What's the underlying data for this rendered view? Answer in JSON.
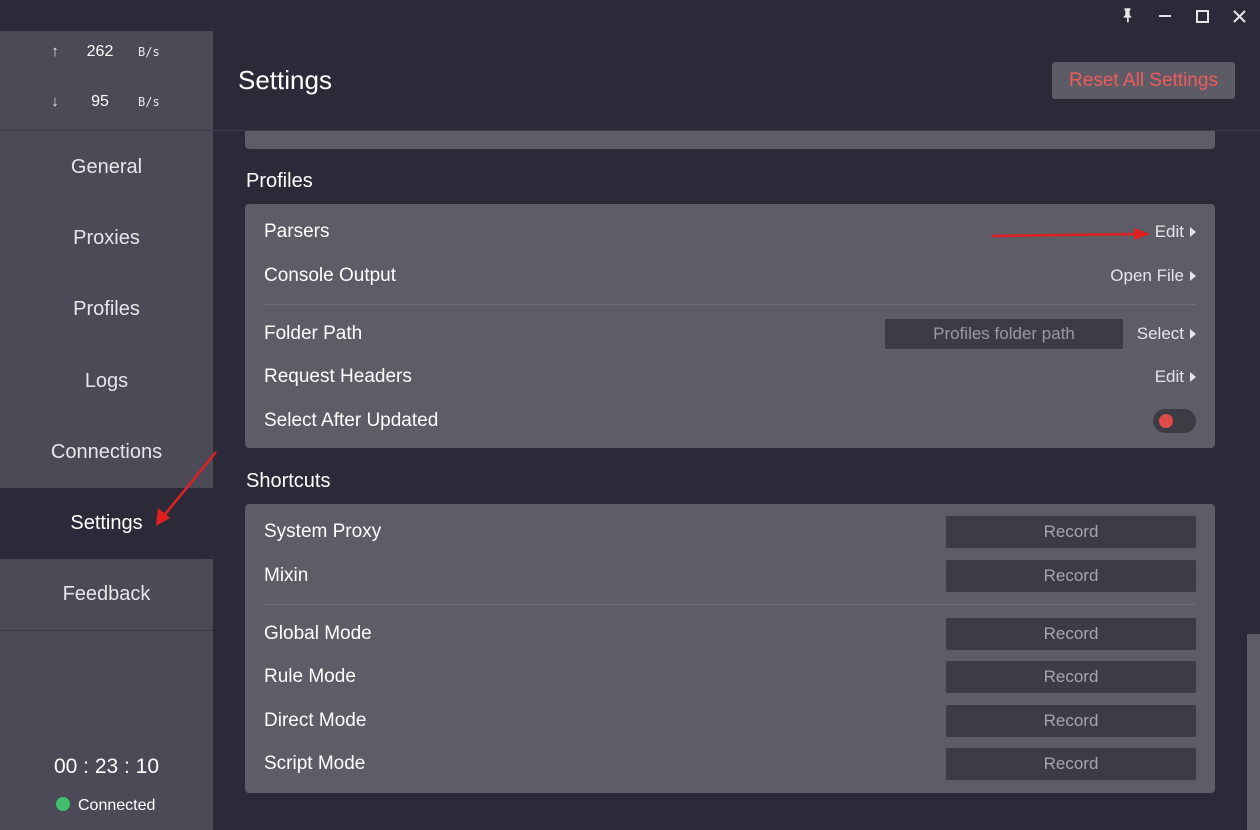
{
  "window": {
    "icons": [
      "pin-icon",
      "minimize-icon",
      "maximize-icon",
      "close-icon"
    ],
    "pin_glyph": "📌",
    "minimize_glyph": "—",
    "maximize_glyph": "☐",
    "close_glyph": "✕"
  },
  "traffic": {
    "up_arrow": "↑",
    "up_value": "262",
    "up_unit": "B/s",
    "down_arrow": "↓",
    "down_value": "95",
    "down_unit": "B/s"
  },
  "nav": {
    "items": [
      {
        "label": "General"
      },
      {
        "label": "Proxies"
      },
      {
        "label": "Profiles"
      },
      {
        "label": "Logs"
      },
      {
        "label": "Connections"
      },
      {
        "label": "Settings"
      },
      {
        "label": "Feedback"
      }
    ],
    "active": "Settings"
  },
  "footer": {
    "timer": "00 : 23 : 10",
    "status": "Connected",
    "status_color": "#3fbf6e"
  },
  "header": {
    "title": "Settings",
    "reset_label": "Reset All Settings",
    "reset_color": "#f05a5a"
  },
  "profiles": {
    "title": "Profiles",
    "parsers_label": "Parsers",
    "parsers_action": "Edit",
    "console_label": "Console Output",
    "console_action": "Open File",
    "folder_label": "Folder Path",
    "folder_placeholder": "Profiles folder path",
    "folder_action": "Select",
    "headers_label": "Request Headers",
    "headers_action": "Edit",
    "select_after_label": "Select After Updated",
    "select_after_on": false
  },
  "shortcuts": {
    "title": "Shortcuts",
    "items": [
      {
        "label": "System Proxy",
        "button": "Record"
      },
      {
        "label": "Mixin",
        "button": "Record"
      },
      {
        "label": "Global Mode",
        "button": "Record"
      },
      {
        "label": "Rule Mode",
        "button": "Record"
      },
      {
        "label": "Direct Mode",
        "button": "Record"
      },
      {
        "label": "Script Mode",
        "button": "Record"
      }
    ]
  },
  "colors": {
    "background": "#2c2a38",
    "sidebar": "#4b4a56",
    "card": "#5d5c67",
    "annotation_arrow": "#e02020"
  }
}
